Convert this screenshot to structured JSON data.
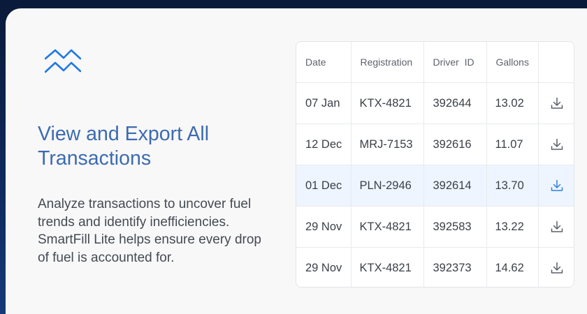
{
  "hero": {
    "logo_icon": "chevrons-up-logo-icon",
    "title": "View and Export All Transactions",
    "description": "Analyze transactions to uncover fuel trends and identify inefficiencies. SmartFill Lite helps ensure every drop of fuel is accounted for."
  },
  "colors": {
    "accent": "#3c6bb0",
    "logo": "#1e78e6",
    "highlight_row": "#eef5fe",
    "highlight_icon": "#2f7fe0",
    "default_icon": "#5a6068"
  },
  "table": {
    "columns": [
      "Date",
      "Registration",
      "Driver  ID",
      "Gallons",
      ""
    ],
    "rows": [
      {
        "date": "07 Jan",
        "registration": "KTX-4821",
        "driver_id": "392644",
        "gallons": "13.02",
        "action_icon": "download-icon",
        "highlighted": false
      },
      {
        "date": "12 Dec",
        "registration": "MRJ-7153",
        "driver_id": "392616",
        "gallons": "11.07",
        "action_icon": "download-icon",
        "highlighted": false
      },
      {
        "date": "01 Dec",
        "registration": "PLN-2946",
        "driver_id": "392614",
        "gallons": "13.70",
        "action_icon": "download-icon",
        "highlighted": true
      },
      {
        "date": "29 Nov",
        "registration": "KTX-4821",
        "driver_id": "392583",
        "gallons": "13.22",
        "action_icon": "download-icon",
        "highlighted": false
      },
      {
        "date": "29 Nov",
        "registration": "KTX-4821",
        "driver_id": "392373",
        "gallons": "14.62",
        "action_icon": "download-icon",
        "highlighted": false
      }
    ]
  }
}
